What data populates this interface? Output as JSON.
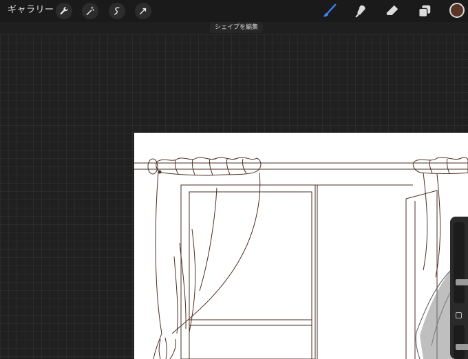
{
  "topbar": {
    "gallery_label": "ギャラリー",
    "tools_left": [
      "wrench-icon",
      "magic-wand-icon",
      "selection-icon",
      "transform-arrow-icon"
    ],
    "tools_right": [
      "brush-icon",
      "smudge-icon",
      "eraser-icon",
      "layers-icon"
    ],
    "active_tool": "brush-icon",
    "active_color": "#5a3427",
    "accent_color": "#3b82f6"
  },
  "tooltip": {
    "text": "シェイプを編集"
  },
  "sidebar": {
    "brush_size_level": 0.24,
    "opacity_level": 0.33
  }
}
